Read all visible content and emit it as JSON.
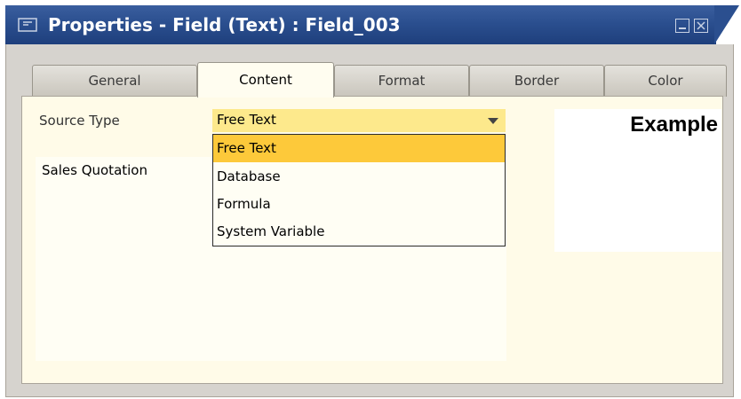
{
  "window": {
    "title": "Properties - Field (Text) : Field_003"
  },
  "tabs": [
    {
      "label": "General",
      "active": false
    },
    {
      "label": "Content",
      "active": true
    },
    {
      "label": "Format",
      "active": false
    },
    {
      "label": "Border",
      "active": false
    },
    {
      "label": "Color",
      "active": false
    }
  ],
  "content": {
    "source_type_label": "Source Type",
    "source_type_value": "Free Text",
    "text_value": "Sales Quotation",
    "dropdown_options": [
      "Free Text",
      "Database",
      "Formula",
      "System Variable"
    ],
    "dropdown_selected_index": 0
  },
  "example": {
    "label": "Example"
  },
  "colors": {
    "title_bar": "#2b4f8f",
    "panel_bg": "#fffbe8",
    "select_bg": "#fde98c",
    "selected_option_bg": "#fdc93a"
  }
}
